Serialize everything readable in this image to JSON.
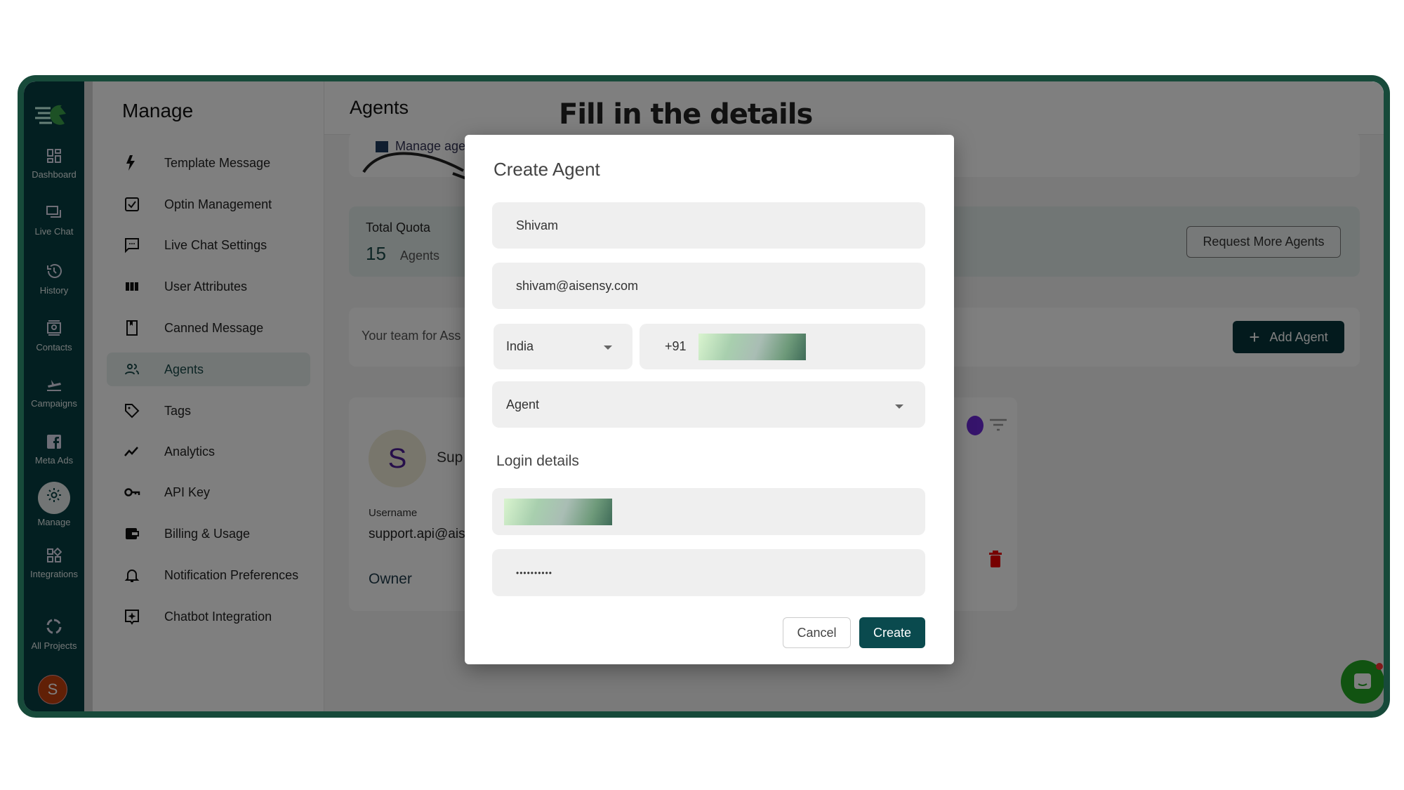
{
  "annotation": {
    "text": "Fill in the details"
  },
  "rail": {
    "items": [
      {
        "label": "Dashboard",
        "icon": "dashboard-icon"
      },
      {
        "label": "Live Chat",
        "icon": "chat-icon"
      },
      {
        "label": "History",
        "icon": "history-icon"
      },
      {
        "label": "Contacts",
        "icon": "contacts-icon"
      },
      {
        "label": "Campaigns",
        "icon": "campaigns-icon"
      },
      {
        "label": "Meta Ads",
        "icon": "facebook-icon"
      },
      {
        "label": "Manage",
        "icon": "gear-icon",
        "active": true
      },
      {
        "label": "Integrations",
        "icon": "integrations-icon"
      },
      {
        "label": "All Projects",
        "icon": "projects-icon"
      }
    ],
    "avatar": "S"
  },
  "manage": {
    "title": "Manage",
    "items": [
      {
        "label": "Template Message",
        "icon": "bolt-icon"
      },
      {
        "label": "Optin Management",
        "icon": "checkbox-icon"
      },
      {
        "label": "Live Chat Settings",
        "icon": "message-icon"
      },
      {
        "label": "User Attributes",
        "icon": "columns-icon"
      },
      {
        "label": "Canned Message",
        "icon": "bookmark-icon"
      },
      {
        "label": "Agents",
        "icon": "people-icon",
        "active": true
      },
      {
        "label": "Tags",
        "icon": "tag-icon"
      },
      {
        "label": "Analytics",
        "icon": "trend-icon"
      },
      {
        "label": "API Key",
        "icon": "key-icon"
      },
      {
        "label": "Billing & Usage",
        "icon": "wallet-icon"
      },
      {
        "label": "Notification Preferences",
        "icon": "bell-icon"
      },
      {
        "label": "Chatbot Integration",
        "icon": "chatbot-icon"
      }
    ]
  },
  "agents_page": {
    "title": "Agents",
    "manage_link": "Manage age",
    "quota_label": "Total Quota",
    "quota_value": "15",
    "quota_unit": "Agents",
    "request_button": "Request More Agents",
    "team_text": "Your team for Ass",
    "add_agent_button": "Add Agent",
    "agent_card": {
      "avatar": "S",
      "name": "Sup",
      "username_label": "Username",
      "username": "support.api@ais",
      "role": "Owner"
    }
  },
  "modal": {
    "title": "Create Agent",
    "name_value": "Shivam",
    "email_value": "shivam@aisensy.com",
    "country_value": "India",
    "phone_code": "+91",
    "role_value": "Agent",
    "login_heading": "Login details",
    "password_value": "••••••••••",
    "cancel_label": "Cancel",
    "create_label": "Create"
  },
  "colors": {
    "frame": "#174a3a",
    "rail": "#073f42",
    "primary": "#0a4a4e",
    "chat": "#22a722"
  }
}
